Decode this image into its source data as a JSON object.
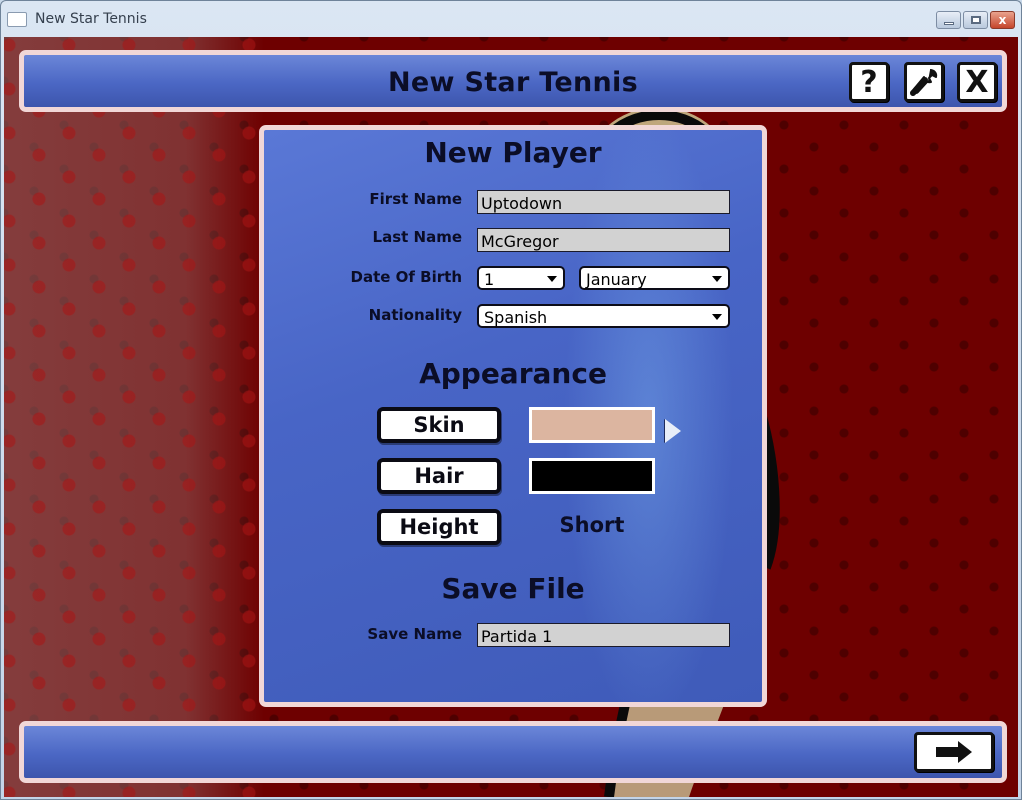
{
  "window": {
    "title": "New Star Tennis",
    "controls": {
      "minimize": "minimize-icon",
      "maximize": "maximize-icon",
      "close": "close-icon",
      "close_glyph": "x"
    }
  },
  "header": {
    "title": "New Star Tennis",
    "buttons": {
      "help": {
        "icon": "question-mark-icon",
        "glyph": "?"
      },
      "settings": {
        "icon": "wrench-icon"
      },
      "quit": {
        "icon": "x-icon",
        "glyph": "X"
      }
    }
  },
  "new_player": {
    "title": "New Player",
    "first_name": {
      "label": "First Name",
      "value": "Uptodown"
    },
    "last_name": {
      "label": "Last Name",
      "value": "McGregor"
    },
    "date_of_birth": {
      "label": "Date Of Birth",
      "day": "1",
      "month": "January"
    },
    "nationality": {
      "label": "Nationality",
      "value": "Spanish"
    }
  },
  "appearance": {
    "title": "Appearance",
    "skin": {
      "label": "Skin",
      "color": "#dcb5a0"
    },
    "hair": {
      "label": "Hair",
      "color": "#000000"
    },
    "height": {
      "label": "Height",
      "value": "Short"
    },
    "cycle_icon": "play-arrow-icon"
  },
  "save_file": {
    "title": "Save File",
    "save_name": {
      "label": "Save Name",
      "value": "Partida 1"
    }
  },
  "footer": {
    "next_icon": "right-arrow-icon"
  },
  "colors": {
    "panel_blue": "#4b67c4",
    "background_red": "#6e0000",
    "border_pink": "#f1d7d7",
    "text_dark": "#0b0d26"
  }
}
